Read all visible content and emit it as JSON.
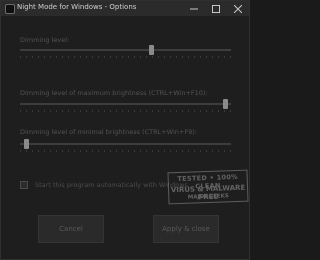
{
  "window": {
    "title": "Night Mode for Windows - Options",
    "icon": "night-mode-app-icon"
  },
  "controls": {
    "minimize_icon": "minimize-icon",
    "maximize_icon": "maximize-icon",
    "close_icon": "close-icon"
  },
  "sliders": [
    {
      "label": "Dimming level:",
      "value_fraction": 0.62
    },
    {
      "label": "Dimming level of maximum brightness (CTRL+Win+F10):",
      "value_fraction": 0.97
    },
    {
      "label": "Dimming level of minimal brightness (CTRL+Win+F9):",
      "value_fraction": 0.03
    }
  ],
  "autostart": {
    "label": "Start this program automatically with Windows",
    "checked": false
  },
  "buttons": {
    "cancel": "Cancel",
    "apply": "Apply & close"
  },
  "badge": {
    "line1": "TESTED • 100% CLEAN",
    "line2": "VIRUS & MALWARE FREE",
    "line3": "MAJORGEEKS"
  },
  "colors": {
    "background": "#1e1e1e",
    "titlebar": "#2b2b2b",
    "text_dim": "#535353"
  }
}
